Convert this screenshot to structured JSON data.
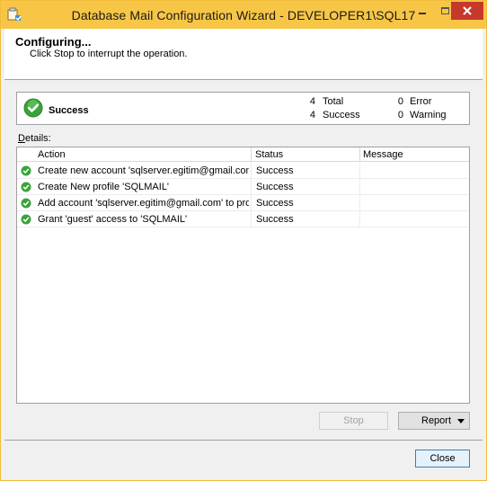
{
  "window": {
    "title": "Database Mail Configuration Wizard - DEVELOPER1\\SQL17",
    "accent_color": "#f7c646",
    "close_color": "#c7382c"
  },
  "header": {
    "title": "Configuring...",
    "subtitle": "Click Stop to interrupt the operation."
  },
  "summary": {
    "status": "Success",
    "total_count": "4",
    "total_label": "Total",
    "success_count": "4",
    "success_label": "Success",
    "error_count": "0",
    "error_label": "Error",
    "warning_count": "0",
    "warning_label": "Warning"
  },
  "details": {
    "label_accel": "D",
    "label_rest": "etails:",
    "columns": [
      "Action",
      "Status",
      "Message"
    ],
    "rows": [
      {
        "action": "Create new account 'sqlserver.egitim@gmail.com' for SM...",
        "status": "Success",
        "message": ""
      },
      {
        "action": "Create New profile 'SQLMAIL'",
        "status": "Success",
        "message": ""
      },
      {
        "action": "Add account 'sqlserver.egitim@gmail.com' to profile 'SQL...",
        "status": "Success",
        "message": ""
      },
      {
        "action": "Grant 'guest' access to 'SQLMAIL'",
        "status": "Success",
        "message": ""
      }
    ]
  },
  "buttons": {
    "stop": "Stop",
    "report": "Report",
    "close": "Close"
  },
  "icons": {
    "app": "database-wizard-icon",
    "success": "success-check-icon",
    "row_success": "row-success-check-icon",
    "success_color": "#3aa33a"
  }
}
